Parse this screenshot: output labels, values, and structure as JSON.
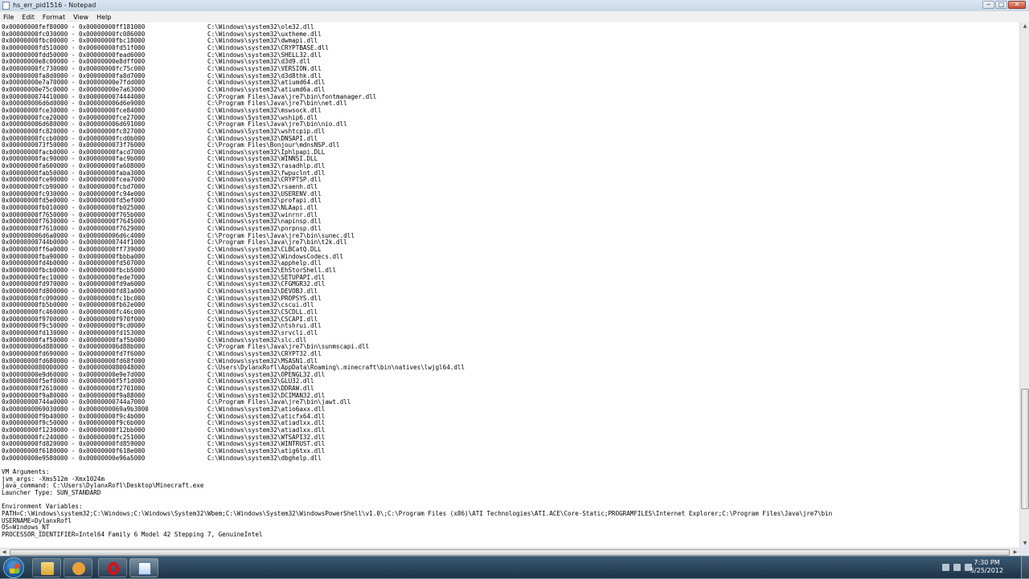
{
  "window": {
    "title": "hs_err_pid1516 - Notepad",
    "controls": {
      "minimize": "─",
      "maximize": "□",
      "close": "✕"
    }
  },
  "menu": {
    "items": [
      "File",
      "Edit",
      "Format",
      "View",
      "Help"
    ]
  },
  "editor": {
    "lines": [
      "0x00000000fef80000 - 0x00000000ff181000 \tC:\\Windows\\system32\\ole32.dll",
      "0x00000000fc030000 - 0x00000000fc086000 \tC:\\Windows\\system32\\uxtheme.dll",
      "0x00000000fbc00000 - 0x00000000fbc18000 \tC:\\Windows\\system32\\dwmapi.dll",
      "0x00000000fd510000 - 0x00000000fd51f000 \tC:\\Windows\\system32\\CRYPTBASE.dll",
      "0x00000000fdd50000 - 0x00000000fead6000 \tC:\\Windows\\system32\\SHELL32.dll",
      "0x00000000e8c00000 - 0x00000000e8dff000 \tC:\\Windows\\system32\\d3d9.dll",
      "0x00000000fc730000 - 0x00000000fc75c000 \tC:\\Windows\\system32\\VERSION.dll",
      "0x00000000fa8d0000 - 0x00000000fa8d7000 \tC:\\Windows\\system32\\d3d8thk.dll",
      "0x00000000e7a70000 - 0x00000000e7fdd000 \tC:\\Windows\\system32\\atiumd64.dll",
      "0x00000000e75c0000 - 0x00000000e7a63000 \tC:\\Windows\\system32\\atiumd6a.dll",
      "0x0000000074410000 - 0x0000000074444000 \tC:\\Program Files\\Java\\jre7\\bin\\fontmanager.dll",
      "0x000000006d6d0000 - 0x000000006d6e9000 \tC:\\Program Files\\Java\\jre7\\bin\\net.dll",
      "0x00000000fce30000 - 0x00000000fce84000 \tC:\\Windows\\system32\\mswsock.dll",
      "0x00000000fce20000 - 0x00000000fce27000 \tC:\\Windows\\System32\\wship6.dll",
      "0x000000006d680000 - 0x000000006d691000 \tC:\\Program Files\\Java\\jre7\\bin\\nio.dll",
      "0x00000000fc820000 - 0x00000000fc827000 \tC:\\Windows\\System32\\wshtcpip.dll",
      "0x00000000fccb0000 - 0x00000000fcd0b000 \tC:\\Windows\\system32\\DNSAPI.dll",
      "0x0000000073f50000 - 0x0000000073f76000 \tC:\\Program Files\\Bonjour\\mdnsNSP.dll",
      "0x00000000facb0000 - 0x00000000facd7000 \tC:\\Windows\\system32\\Iphlpapi.DLL",
      "0x00000000fac90000 - 0x00000000fac9b000 \tC:\\Windows\\system32\\WINNSI.DLL",
      "0x00000000fa600000 - 0x00000000fa608000 \tC:\\Windows\\system32\\rasadhlp.dll",
      "0x00000000fab50000 - 0x00000000faba3000 \tC:\\Windows\\System32\\fwpuclnt.dll",
      "0x00000000fce90000 - 0x00000000fcea7000 \tC:\\Windows\\system32\\CRYPTSP.dll",
      "0x00000000fcb90000 - 0x00000000fcbd7000 \tC:\\Windows\\system32\\rsaenh.dll",
      "0x00000000fc930000 - 0x00000000fc94e000 \tC:\\Windows\\system32\\USERENV.dll",
      "0x00000000fd5e0000 - 0x00000000fd5ef000 \tC:\\Windows\\system32\\profapi.dll",
      "0x00000000fb010000 - 0x00000000fb025000 \tC:\\Windows\\system32\\NLAapi.dll",
      "0x00000000f7650000 - 0x00000000f765b000 \tC:\\Windows\\System32\\winrnr.dll",
      "0x00000000f7630000 - 0x00000000f7645000 \tC:\\Windows\\system32\\napinsp.dll",
      "0x00000000f7610000 - 0x00000000f7629000 \tC:\\Windows\\system32\\pnrpnsp.dll",
      "0x000000006d6a0000 - 0x000000006d6c4000 \tC:\\Program Files\\Java\\jre7\\bin\\sunec.dll",
      "0x00000000744b0000 - 0x00000000744f1000 \tC:\\Program Files\\Java\\jre7\\bin\\t2k.dll",
      "0x00000000ff6a0000 - 0x00000000ff739000 \tC:\\Windows\\system32\\CLBCatQ.DLL",
      "0x00000000fba90000 - 0x00000000fbbba000 \tC:\\Windows\\system32\\WindowsCodecs.dll",
      "0x00000000fd4b0000 - 0x00000000fd507000 \tC:\\Windows\\system32\\apphelp.dll",
      "0x00000000fbcb0000 - 0x00000000fbcb5000 \tC:\\Windows\\system32\\EhStorShell.dll",
      "0x00000000fec10000 - 0x00000000fede7000 \tC:\\Windows\\system32\\SETUPAPI.dll",
      "0x00000000fd970000 - 0x00000000fd9a6000 \tC:\\Windows\\system32\\CFGMGR32.dll",
      "0x00000000fd800000 - 0x00000000fd81a000 \tC:\\Windows\\system32\\DEVOBJ.dll",
      "0x00000000fc090000 - 0x00000000fc1bc000 \tC:\\Windows\\system32\\PROPSYS.dll",
      "0x00000000fb5b0000 - 0x00000000fb62e000 \tC:\\Windows\\system32\\cscui.dll",
      "0x00000000fc460000 - 0x00000000fc46c000 \tC:\\Windows\\System32\\CSCDLL.dll",
      "0x00000000f9700000 - 0x00000000f970f000 \tC:\\Windows\\system32\\CSCAPI.dll",
      "0x00000000f9c50000 - 0x00000000f9cd0000 \tC:\\Windows\\system32\\ntshrui.dll",
      "0x00000000fd130000 - 0x00000000fd153000 \tC:\\Windows\\system32\\srvcli.dll",
      "0x00000000faf50000 - 0x00000000faf5b000 \tC:\\Windows\\system32\\slc.dll",
      "0x000000006d880000 - 0x000000006d88b000 \tC:\\Program Files\\Java\\jre7\\bin\\sunmscapi.dll",
      "0x00000000fd690000 - 0x00000000fd7f6000 \tC:\\Windows\\system32\\CRYPT32.dll",
      "0x00000000fd680000 - 0x00000000fd68f000 \tC:\\Windows\\system32\\MSASN1.dll",
      "0x0000000080000000 - 0x0000000080048000 \tC:\\Users\\DylanxRofl\\AppData\\Roaming\\.minecraft\\bin\\natives\\lwjgl64.dll",
      "0x00000000e9d60000 - 0x00000000e9e7d000 \tC:\\Windows\\system32\\OPENGL32.dll",
      "0x00000000f5ef0000 - 0x00000000f5f1d000 \tC:\\Windows\\system32\\GLU32.dll",
      "0x00000000f2610000 - 0x00000000f2701000 \tC:\\Windows\\system32\\DDRAW.dll",
      "0x00000000f9a80000 - 0x00000000f9a88000 \tC:\\Windows\\system32\\DCIMAN32.dll",
      "0x00000000744a0000 - 0x00000000744a7000 \tC:\\Program Files\\Java\\jre7\\bin\\jawt.dll",
      "0x0000000069030000 - 0x0000000069a9b3000 \tC:\\Windows\\system32\\atio6axx.dll",
      "0x00000000f9b40000 - 0x00000000f9c4b000 \tC:\\Windows\\system32\\aticfx64.dll",
      "0x00000000f9c50000 - 0x00000000f9c6b000 \tC:\\Windows\\system32\\atiadlxx.dll",
      "0x00000000f1230000 - 0x00000000f12bb000 \tC:\\Windows\\system32\\atiadlxx.dll",
      "0x00000000fc240000 - 0x00000000fc251000 \tC:\\Windows\\system32\\WTSAPI32.dll",
      "0x00000000fd820000 - 0x00000000fd859000 \tC:\\Windows\\system32\\WINTRUST.dll",
      "0x00000000f6180000 - 0x00000000f618e000 \tC:\\Windows\\system32\\atig6txx.dll",
      "0x00000000e9580000 - 0x00000000e96a5000 \tC:\\Windows\\system32\\dbghelp.dll",
      "",
      "VM Arguments:",
      "jvm_args: -Xms512m -Xmx1024m",
      "java_command: C:\\Users\\DylanxRofl\\Desktop\\Minecraft.exe",
      "Launcher Type: SUN_STANDARD",
      "",
      "Environment Variables:",
      "PATH=C:\\Windows\\system32;C:\\Windows;C:\\Windows\\System32\\Wbem;C:\\Windows\\System32\\WindowsPowerShell\\v1.0\\;C:\\Program Files (x86)\\ATI Technologies\\ATI.ACE\\Core-Static;PROGRAMFILES\\Internet Explorer;C:\\Program Files\\Java\\jre7\\bin",
      "USERNAME=DylanxRofl",
      "OS=Windows_NT",
      "PROCESSOR_IDENTIFIER=Intel64 Family 6 Model 42 Stepping 7, GenuineIntel"
    ]
  },
  "scrollbars": {
    "up_arrow": "▲",
    "down_arrow": "▼",
    "left_arrow": "◀",
    "right_arrow": "▶"
  },
  "taskbar": {
    "apps": [
      {
        "name": "Windows Explorer",
        "icon": "folder-icon"
      },
      {
        "name": "Media Player",
        "icon": "media-player-icon"
      },
      {
        "name": "Opera",
        "icon": "opera-icon"
      },
      {
        "name": "Notepad",
        "icon": "notepad-icon"
      }
    ],
    "clock": {
      "time": "7:30 PM",
      "date": "5/25/2012"
    }
  }
}
